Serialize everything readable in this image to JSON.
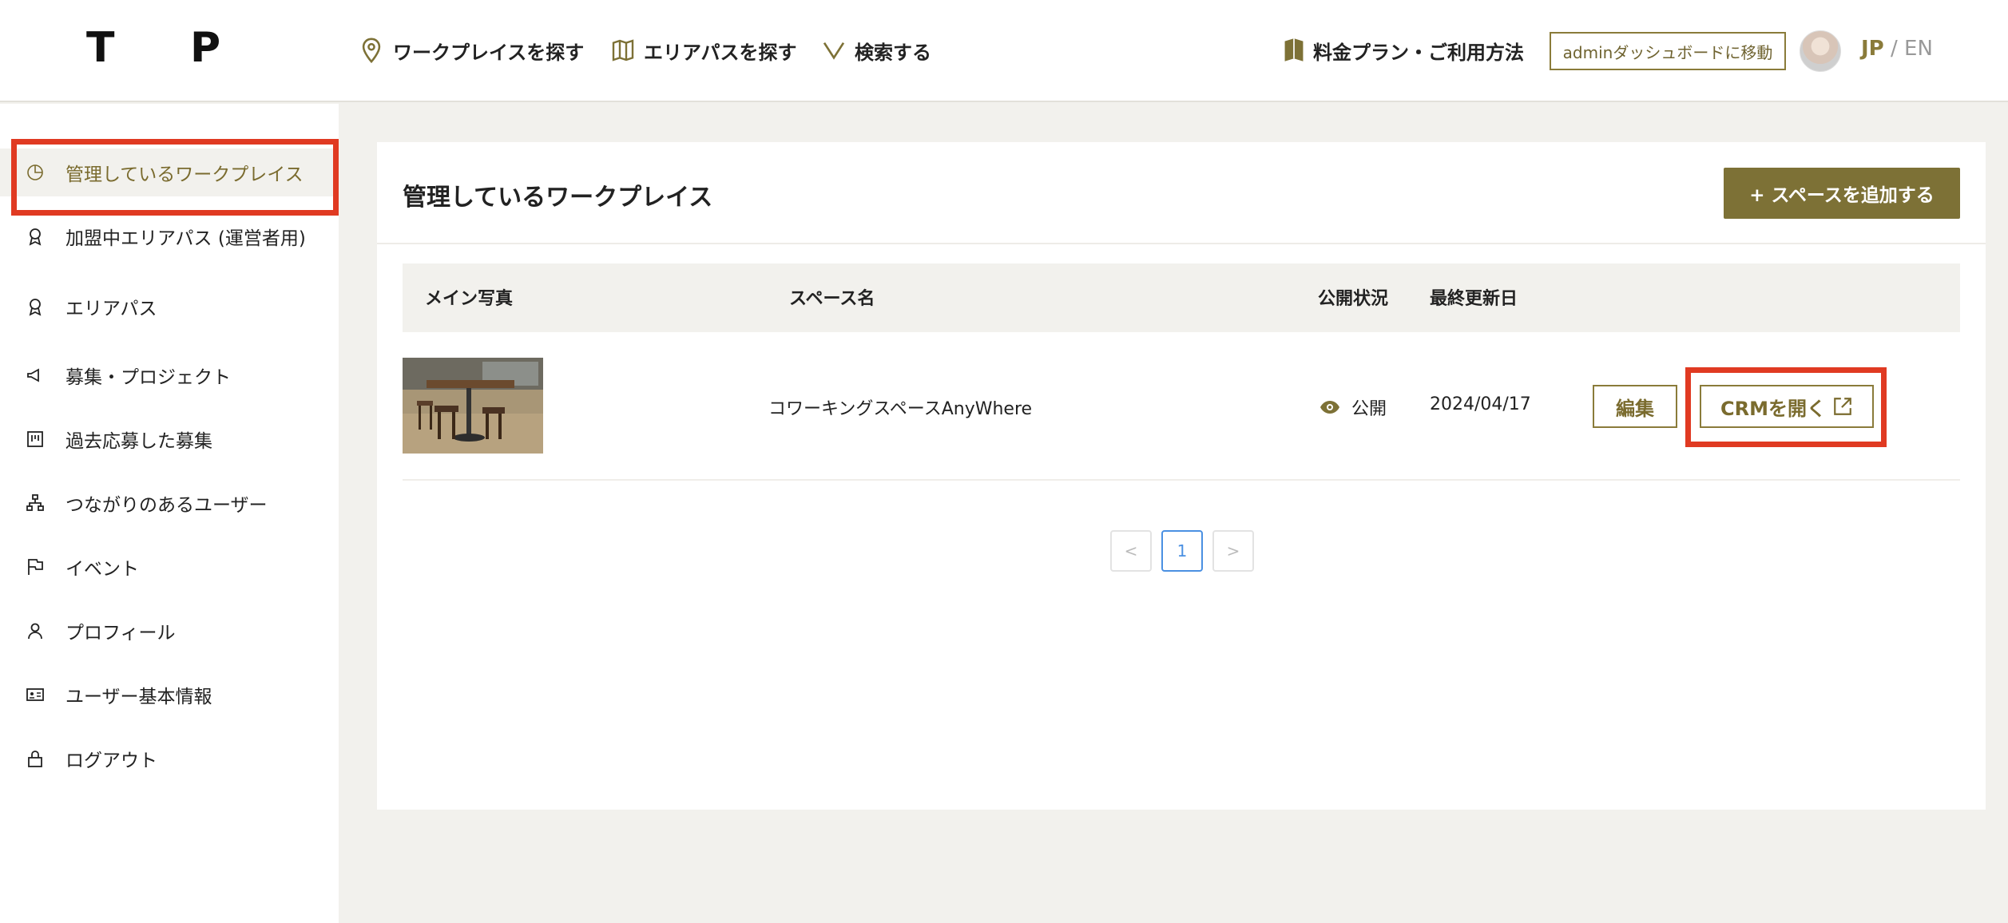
{
  "header": {
    "logo_left": "T",
    "logo_right": "P",
    "nav": [
      {
        "label": "ワークプレイスを探す",
        "icon": "location-pin-icon"
      },
      {
        "label": "エリアパスを探す",
        "icon": "map-icon"
      },
      {
        "label": "検索する",
        "icon": "chevron-down-icon"
      }
    ],
    "plan_label": "料金プラン・ご利用方法",
    "admin_button": "adminダッシュボードに移動",
    "lang_jp": "JP",
    "lang_sep": "/",
    "lang_en": "EN"
  },
  "sidebar": {
    "items": [
      {
        "label": "管理しているワークプレイス",
        "icon": "pie-chart-icon",
        "active": true
      },
      {
        "label": "加盟中エリアパス (運営者用)",
        "icon": "badge-icon"
      },
      {
        "label": "エリアパス",
        "icon": "badge-icon"
      },
      {
        "label": "募集・プロジェクト",
        "icon": "megaphone-icon"
      },
      {
        "label": "過去応募した募集",
        "icon": "board-icon"
      },
      {
        "label": "つながりのあるユーザー",
        "icon": "network-icon"
      },
      {
        "label": "イベント",
        "icon": "flag-icon"
      },
      {
        "label": "プロフィール",
        "icon": "user-icon"
      },
      {
        "label": "ユーザー基本情報",
        "icon": "id-card-icon"
      },
      {
        "label": "ログアウト",
        "icon": "lock-icon"
      }
    ]
  },
  "main": {
    "title": "管理しているワークプレイス",
    "add_button": "+ スペースを追加する",
    "table": {
      "headers": [
        "メイン写真",
        "スペース名",
        "公開状況",
        "最終更新日"
      ],
      "rows": [
        {
          "name": "コワーキングスペースAnyWhere",
          "status": "公開",
          "updated": "2024/04/17",
          "edit": "編集",
          "crm": "CRMを開く"
        }
      ]
    },
    "pagination": {
      "prev": "<",
      "current": "1",
      "next": ">"
    }
  },
  "colors": {
    "accent": "#7d7136",
    "highlight": "#e03a22",
    "link": "#4a90e2"
  }
}
